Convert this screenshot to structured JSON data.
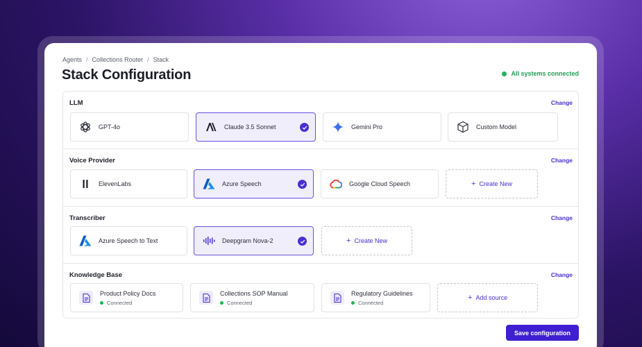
{
  "breadcrumb": [
    "Agents",
    "Collections Router",
    "Stack"
  ],
  "page_title": "Stack Configuration",
  "status": {
    "label": "All systems connected",
    "color": "#22b35a"
  },
  "change_label": "Change",
  "sections": {
    "llm": {
      "title": "LLM",
      "cards": [
        {
          "label": "GPT-4o",
          "icon": "openai-icon",
          "selected": false
        },
        {
          "label": "Claude 3.5 Sonnet",
          "icon": "anthropic-icon",
          "selected": true
        },
        {
          "label": "Gemini Pro",
          "icon": "gemini-icon",
          "selected": false
        },
        {
          "label": "Custom Model",
          "icon": "cube-icon",
          "selected": false
        }
      ]
    },
    "voice": {
      "title": "Voice Provider",
      "cards": [
        {
          "label": "ElevenLabs",
          "icon": "elevenlabs-icon",
          "selected": false
        },
        {
          "label": "Azure Speech",
          "icon": "azure-icon",
          "selected": true
        },
        {
          "label": "Google Cloud Speech",
          "icon": "google-cloud-icon",
          "selected": false
        }
      ],
      "create_label": "Create New"
    },
    "transcriber": {
      "title": "Transcriber",
      "cards": [
        {
          "label": "Azure Speech to Text",
          "icon": "azure-icon",
          "selected": false
        },
        {
          "label": "Deepgram Nova-2",
          "icon": "deepgram-icon",
          "selected": true
        }
      ],
      "create_label": "Create New"
    },
    "kb": {
      "title": "Knowledge Base",
      "items": [
        {
          "label": "Product Policy Docs",
          "status": "Connected"
        },
        {
          "label": "Collections SOP Manual",
          "status": "Connected"
        },
        {
          "label": "Regulatory Guidelines",
          "status": "Connected"
        }
      ],
      "add_label": "Add source"
    }
  },
  "save_label": "Save configuration",
  "colors": {
    "accent": "#4a2fd6",
    "selected_bg": "#f1eefc",
    "success": "#22b35a"
  }
}
